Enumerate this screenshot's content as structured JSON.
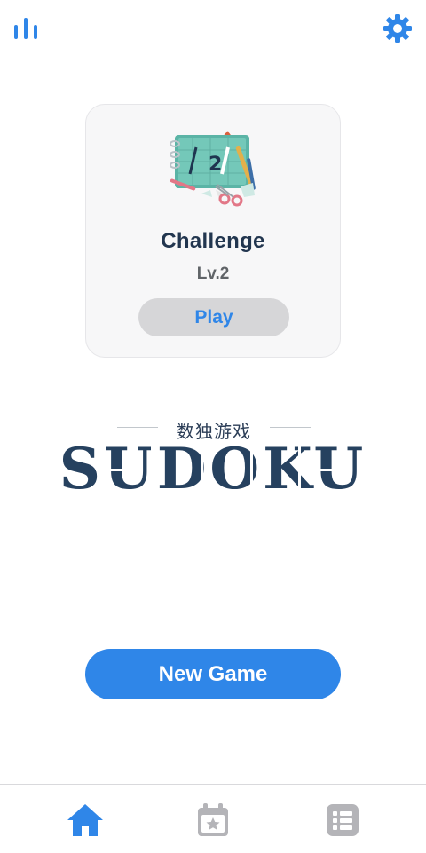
{
  "header": {
    "stats_icon": "bar-chart-icon",
    "settings_icon": "gear-icon"
  },
  "card": {
    "title": "Challenge",
    "level": "Lv.2",
    "play_label": "Play",
    "illustration_text": "2"
  },
  "logo": {
    "subtitle": "数独游戏",
    "title": "SUDOKU"
  },
  "new_game_label": "New Game",
  "tabs": [
    {
      "name": "home",
      "icon": "home-icon",
      "active": true
    },
    {
      "name": "daily",
      "icon": "calendar-star-icon",
      "active": false
    },
    {
      "name": "stats",
      "icon": "list-icon",
      "active": false
    }
  ],
  "colors": {
    "accent": "#2f86e8",
    "title": "#22364f",
    "inactive_icon": "#b4b4b8"
  }
}
